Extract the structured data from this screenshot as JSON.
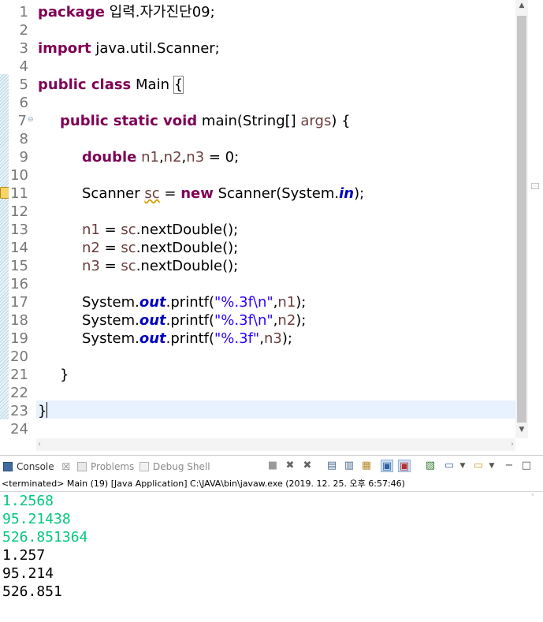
{
  "editor": {
    "line_numbers": [
      "1",
      "2",
      "3",
      "4",
      "5",
      "6",
      "7",
      "8",
      "9",
      "10",
      "11",
      "12",
      "13",
      "14",
      "15",
      "16",
      "17",
      "18",
      "19",
      "20",
      "21",
      "22",
      "23",
      "24"
    ],
    "code": {
      "l1_kw": "package",
      "l1_rest": " 입력.자가진단09;",
      "l3_kw": "import",
      "l3_rest": " java.util.Scanner;",
      "l5_kw": "public class",
      "l5_name": " Main ",
      "l5_brace": "{",
      "l7_kw": "public static void",
      "l7_rest1": " main(String[] ",
      "l7_args": "args",
      "l7_rest2": ") {",
      "l9_kw": "double",
      "l9_n1": "n1",
      "l9_c1": ",",
      "l9_n2": "n2",
      "l9_c2": ",",
      "l9_n3": "n3",
      "l9_rest": " = 0;",
      "l11_type": "Scanner ",
      "l11_sc": "sc",
      "l11_eq": " = ",
      "l11_new": "new",
      "l11_rest1": " Scanner(System.",
      "l11_in": "in",
      "l11_rest2": ");",
      "l13_var": "n1",
      "l13_eq": " = ",
      "l13_sc": "sc",
      "l13_call": ".nextDouble();",
      "l14_var": "n2",
      "l14_eq": " = ",
      "l14_sc": "sc",
      "l14_call": ".nextDouble();",
      "l15_var": "n3",
      "l15_eq": " = ",
      "l15_sc": "sc",
      "l15_call": ".nextDouble();",
      "l17_sys": "System.",
      "l17_out": "out",
      "l17_m": ".printf(",
      "l17_str": "\"%.3f\\n\"",
      "l17_comma": ",",
      "l17_var": "n1",
      "l17_end": ");",
      "l18_sys": "System.",
      "l18_out": "out",
      "l18_m": ".printf(",
      "l18_str": "\"%.3f\\n\"",
      "l18_comma": ",",
      "l18_var": "n2",
      "l18_end": ");",
      "l19_sys": "System.",
      "l19_out": "out",
      "l19_m": ".printf(",
      "l19_str": "\"%.3f\"",
      "l19_comma": ",",
      "l19_var": "n3",
      "l19_end": ");",
      "l21_brace": "}",
      "l23_brace": "}"
    }
  },
  "console": {
    "tabs": {
      "console": "Console",
      "console_close": "☒",
      "problems": "Problems",
      "debug_shell": "Debug Shell"
    },
    "status": "<terminated> Main (19) [Java Application] C:\\JAVA\\bin\\javaw.exe (2019. 12. 25. 오후 6:57:46)",
    "input_lines": [
      "1.2568",
      "95.21438",
      "526.851364"
    ],
    "output_lines": [
      "1.257",
      "95.214",
      "526.851"
    ]
  },
  "colors": {
    "keyword": "#7f0055",
    "string": "#2a00ff",
    "static_field": "#0000c0",
    "local_var": "#6a3e3e",
    "console_input": "#00c87d",
    "current_line": "#e8f2fe"
  },
  "icons": [
    "console-icon",
    "problems-icon",
    "debug-shell-icon",
    "terminate-icon",
    "remove-launch-icon",
    "remove-all-icon",
    "clear-console-icon",
    "scroll-lock-icon",
    "word-wrap-icon",
    "show-stdout-icon",
    "show-stderr-icon",
    "pin-console-icon",
    "display-console-icon",
    "new-console-icon",
    "minimize-icon",
    "maximize-icon"
  ]
}
